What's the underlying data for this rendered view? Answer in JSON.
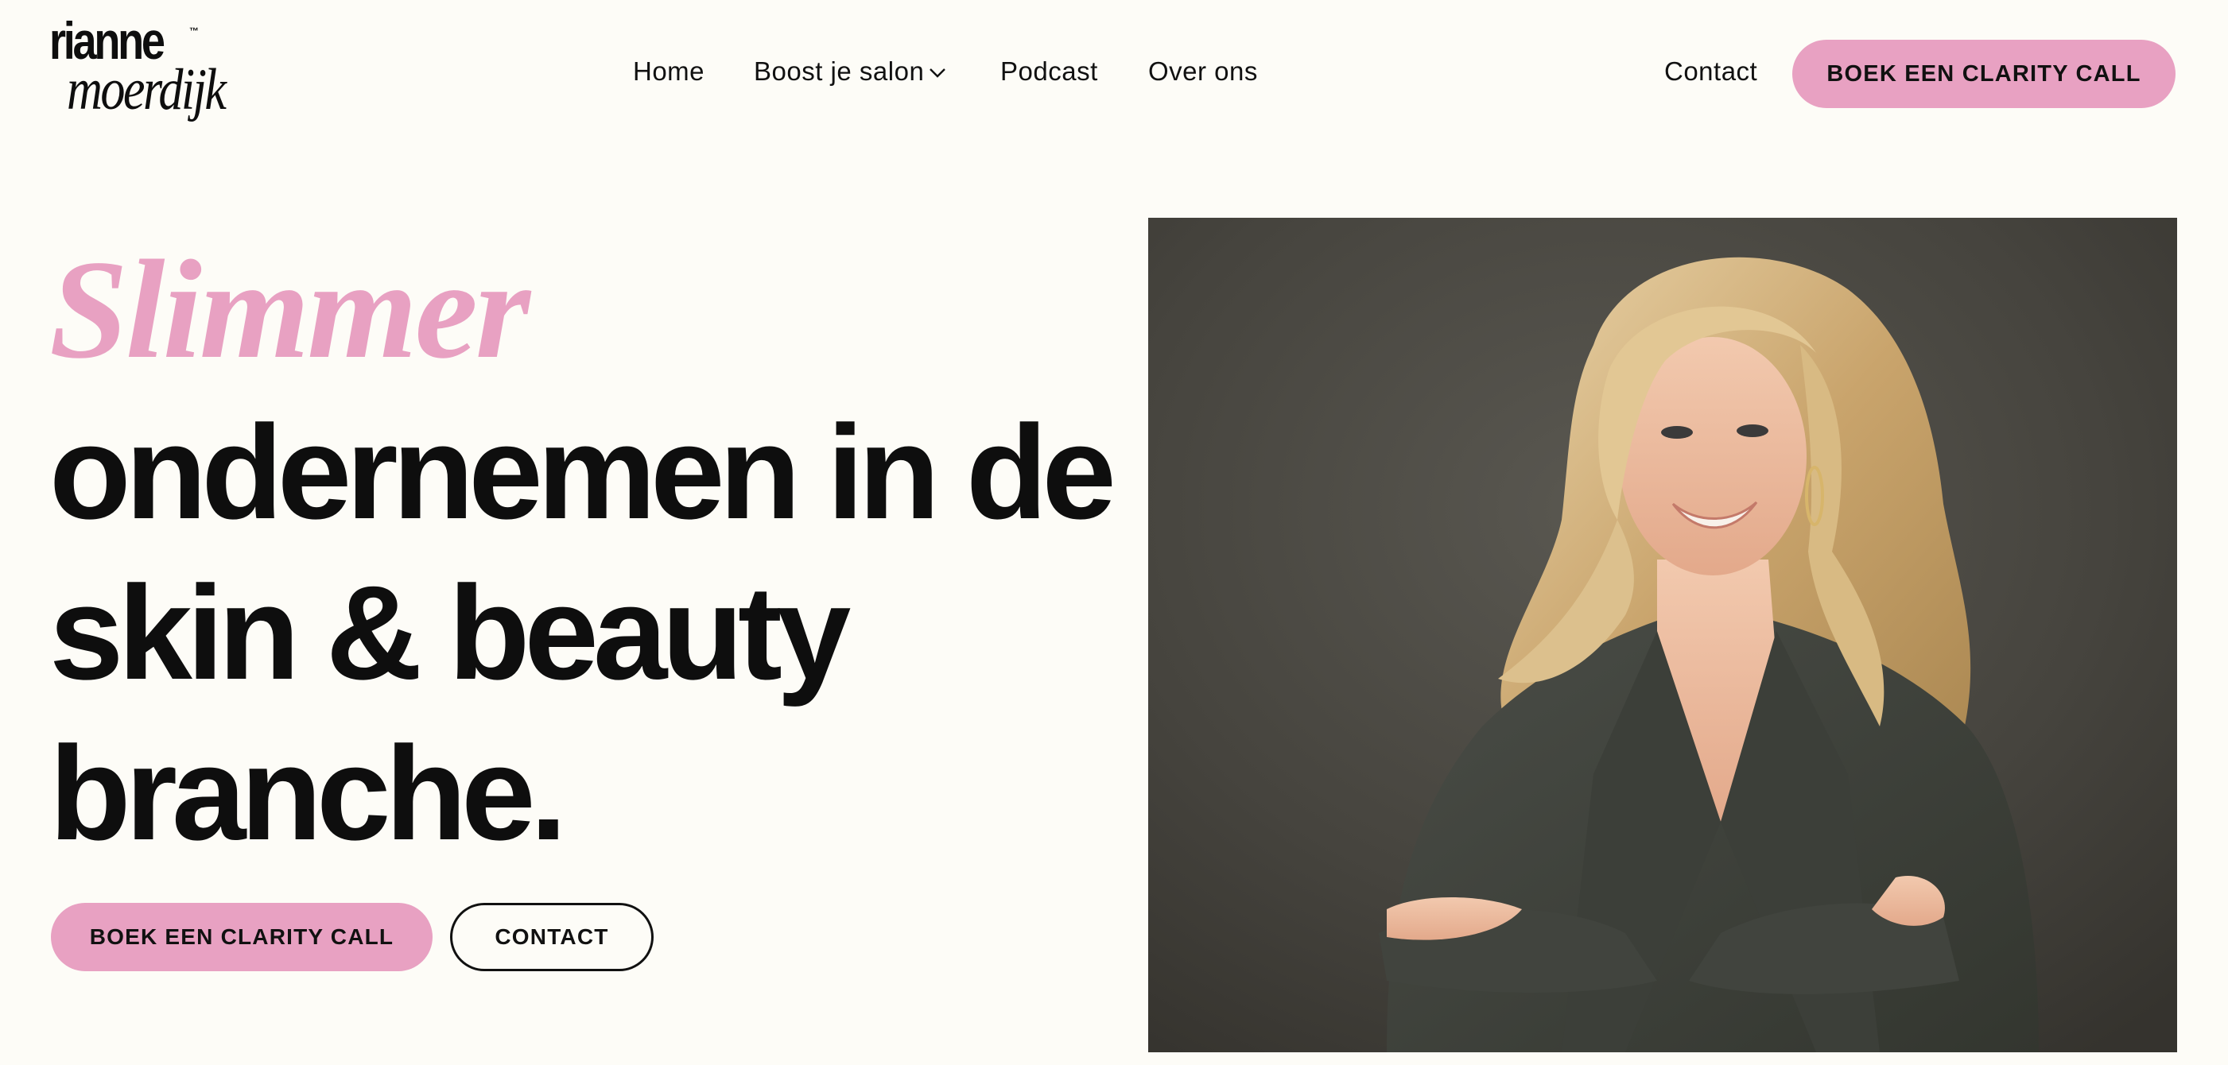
{
  "brand": {
    "line1": "rianne",
    "line2": "moerdijk",
    "tm": "™"
  },
  "nav": {
    "items": [
      {
        "label": "Home"
      },
      {
        "label": "Boost je salon",
        "icon": "chevron-down-icon"
      },
      {
        "label": "Podcast"
      },
      {
        "label": "Over ons"
      }
    ],
    "contact_label": "Contact",
    "cta_label": "BOEK EEN CLARITY CALL"
  },
  "hero": {
    "accent_word": "Slimmer",
    "lines": [
      "ondernemen in de",
      "skin & beauty",
      "branche."
    ],
    "primary_cta": "BOEK EEN CLARITY CALL",
    "secondary_cta": "CONTACT"
  },
  "colors": {
    "background": "#fdfcf7",
    "accent_pink": "#e8a1c2",
    "text": "#0e0e0e"
  }
}
